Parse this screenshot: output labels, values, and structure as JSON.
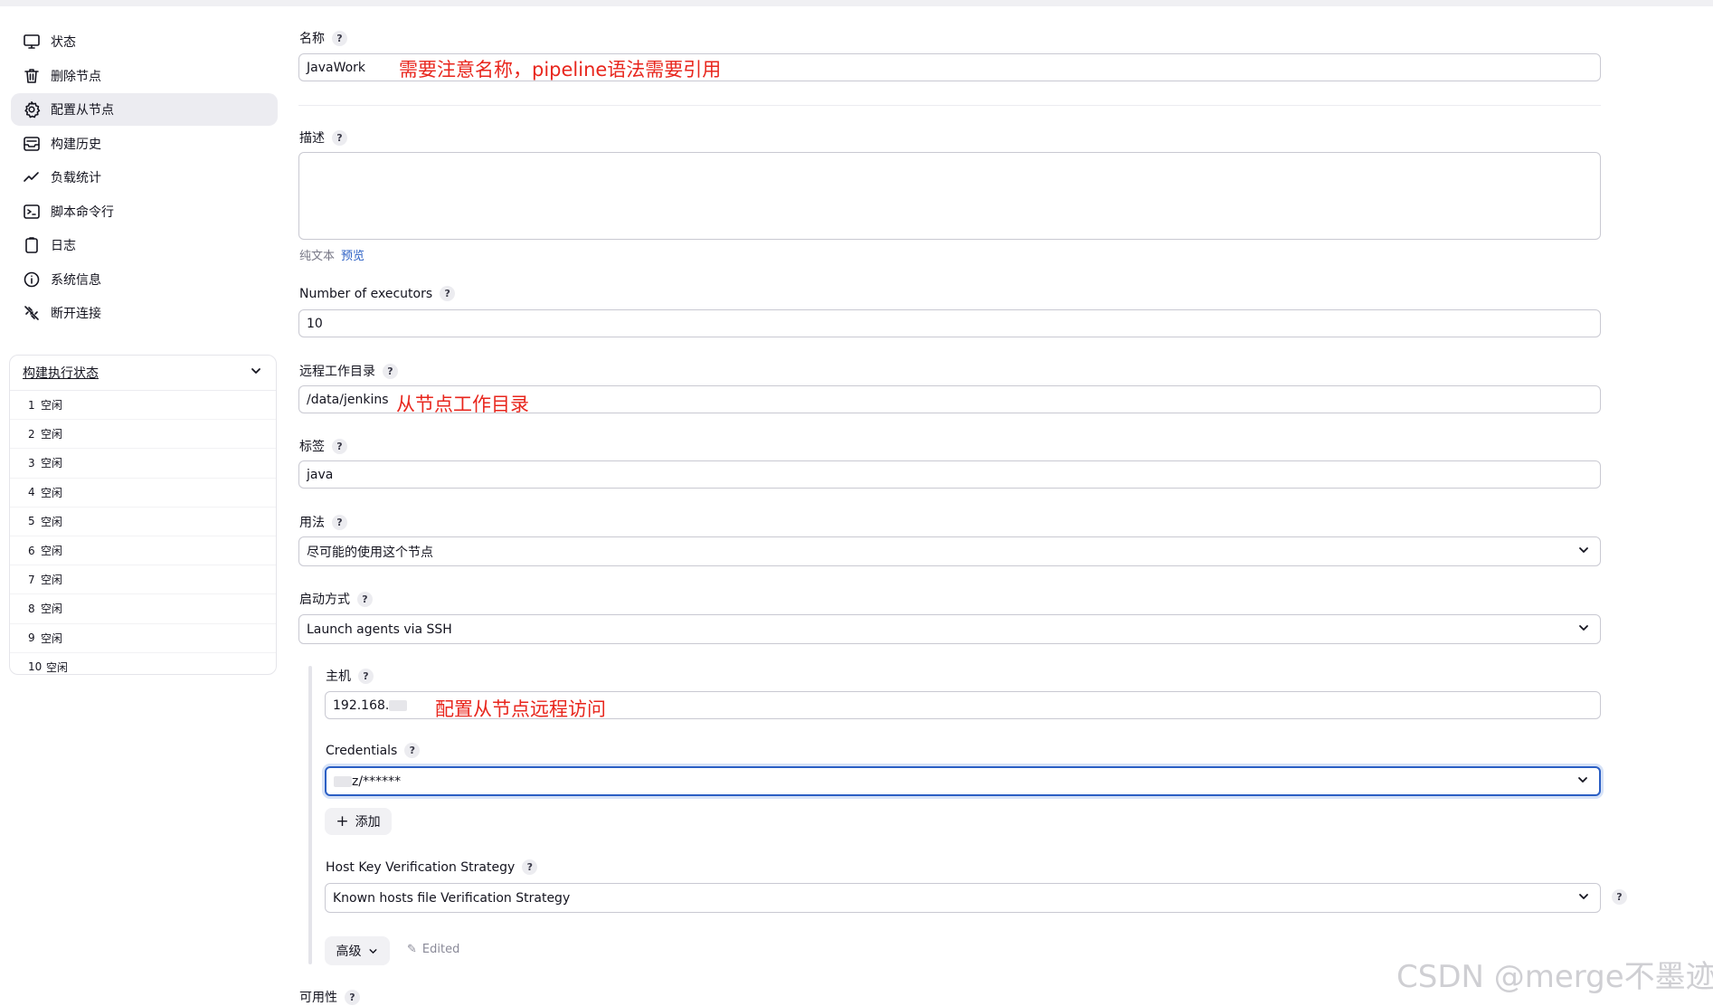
{
  "sidebar": {
    "items": [
      {
        "label": "状态",
        "icon": "monitor-icon"
      },
      {
        "label": "删除节点",
        "icon": "trash-icon"
      },
      {
        "label": "配置从节点",
        "icon": "gear-icon"
      },
      {
        "label": "构建历史",
        "icon": "history-icon"
      },
      {
        "label": "负载统计",
        "icon": "trend-icon"
      },
      {
        "label": "脚本命令行",
        "icon": "terminal-icon"
      },
      {
        "label": "日志",
        "icon": "clipboard-icon"
      },
      {
        "label": "系统信息",
        "icon": "info-icon"
      },
      {
        "label": "断开连接",
        "icon": "disconnect-icon"
      }
    ],
    "active_index": 2
  },
  "executors": {
    "title": "构建执行状态",
    "rows": [
      {
        "num": "1",
        "status": "空闲"
      },
      {
        "num": "2",
        "status": "空闲"
      },
      {
        "num": "3",
        "status": "空闲"
      },
      {
        "num": "4",
        "status": "空闲"
      },
      {
        "num": "5",
        "status": "空闲"
      },
      {
        "num": "6",
        "status": "空闲"
      },
      {
        "num": "7",
        "status": "空闲"
      },
      {
        "num": "8",
        "status": "空闲"
      },
      {
        "num": "9",
        "status": "空闲"
      },
      {
        "num": "10",
        "status": "空闲"
      }
    ]
  },
  "form": {
    "name": {
      "label": "名称",
      "value": "JavaWork",
      "annotation": "需要注意名称，pipeline语法需要引用"
    },
    "description": {
      "label": "描述",
      "value": "",
      "format_plain": "纯文本",
      "format_preview": "预览"
    },
    "executors": {
      "label": "Number of executors",
      "value": "10"
    },
    "remote_dir": {
      "label": "远程工作目录",
      "value": "/data/jenkins",
      "annotation": "从节点工作目录"
    },
    "labels": {
      "label": "标签",
      "value": "java"
    },
    "usage": {
      "label": "用法",
      "value": "尽可能的使用这个节点"
    },
    "launch": {
      "label": "启动方式",
      "value": "Launch agents via SSH"
    },
    "host": {
      "label": "主机",
      "value": "192.168.",
      "annotation": "配置从节点远程访问"
    },
    "credentials": {
      "label": "Credentials",
      "value": "z/******",
      "add_label": "添加"
    },
    "host_key": {
      "label": "Host Key Verification Strategy",
      "value": "Known hosts file Verification Strategy"
    },
    "advanced": {
      "label": "高级",
      "edited": "Edited"
    },
    "availability": {
      "label": "可用性"
    }
  },
  "help_glyph": "?",
  "watermark": "CSDN @merge不墨迹",
  "colors": {
    "annotation": "#e8261d",
    "link": "#2b5fc4",
    "active_nav": "#ececf1"
  }
}
